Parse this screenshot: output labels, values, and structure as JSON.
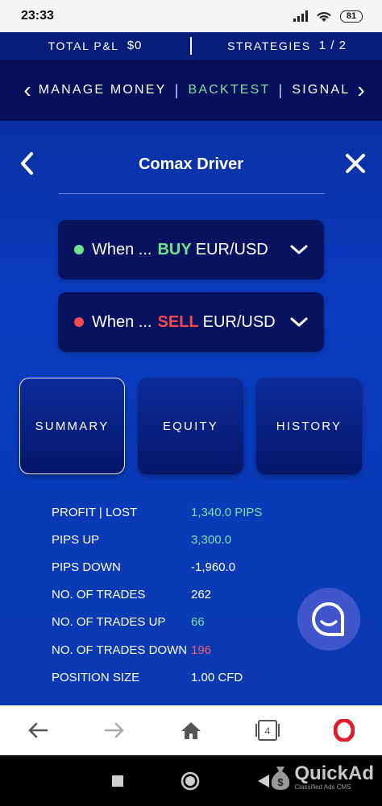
{
  "status_bar": {
    "time": "23:33",
    "battery": "81"
  },
  "topbar": {
    "pnl_label": "TOTAL P&L",
    "pnl_value": "$0",
    "strategies_label": "STRATEGIES",
    "strategies_value": "1 / 2"
  },
  "nav": {
    "items": [
      "MANAGE MONEY",
      "BACKTEST",
      "SIGNAL"
    ],
    "active": "BACKTEST"
  },
  "header": {
    "title": "Comax Driver"
  },
  "conditions": [
    {
      "prefix": "When ...",
      "action": "BUY",
      "pair": "EUR/USD",
      "dot_color": "#6fe38e"
    },
    {
      "prefix": "When ...",
      "action": "SELL",
      "pair": "EUR/USD",
      "dot_color": "#f24b4b"
    }
  ],
  "tabs": [
    {
      "label": "SUMMARY",
      "active": true
    },
    {
      "label": "EQUITY",
      "active": false
    },
    {
      "label": "HISTORY",
      "active": false
    }
  ],
  "stats": [
    {
      "label": "PROFIT | LOST",
      "value": "1,340.0 PIPS",
      "tone": "green"
    },
    {
      "label": "PIPS UP",
      "value": "3,300.0",
      "tone": "green"
    },
    {
      "label": "PIPS DOWN",
      "value": "-1,960.0",
      "tone": "neutral"
    },
    {
      "label": "NO. OF TRADES",
      "value": "262",
      "tone": "neutral"
    },
    {
      "label": "NO. OF TRADES UP",
      "value": "66",
      "tone": "green"
    },
    {
      "label": "NO. OF TRADES DOWN",
      "value": "196",
      "tone": "red"
    },
    {
      "label": "POSITION SIZE",
      "value": "1.00 CFD",
      "tone": "neutral"
    }
  ],
  "browser_nav": {
    "tabs_count": "4"
  },
  "watermark": {
    "brand": "QuickAd",
    "tagline": "Classified Ads CMS"
  },
  "colors": {
    "accent_green": "#6fe38e",
    "accent_red": "#f24b4b",
    "app_blue": "#0a3ab8",
    "nav_dark": "#050f5a"
  }
}
